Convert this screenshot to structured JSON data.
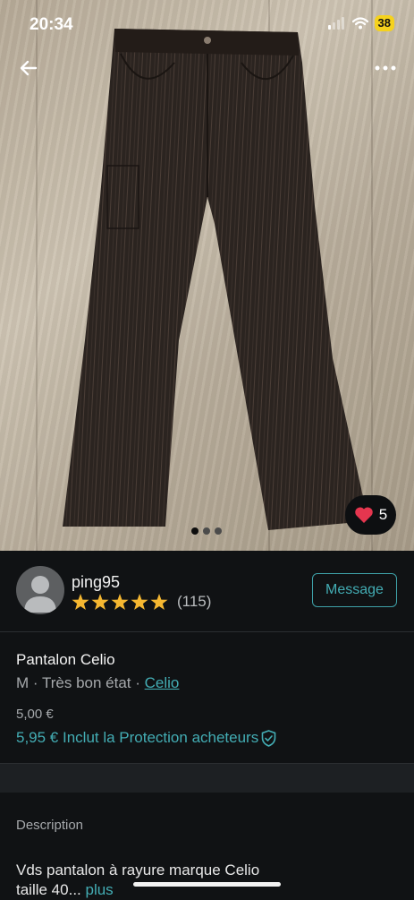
{
  "status_bar": {
    "time": "20:34",
    "battery": "38"
  },
  "photo": {
    "page_count": 3,
    "active_page": 1
  },
  "favorites": {
    "count": "5"
  },
  "seller": {
    "username": "ping95",
    "rating_stars": 5,
    "rating_count": "(115)",
    "message_label": "Message"
  },
  "item": {
    "title": "Pantalon Celio",
    "size": "M",
    "condition": "Très bon état",
    "brand": "Celio",
    "separator": " · ",
    "price": "5,00 €",
    "price_with_protection": "5,95 € Inclut la Protection acheteurs"
  },
  "description": {
    "heading": "Description",
    "line1": "Vds pantalon à rayure marque Celio",
    "line2": "taille 40...",
    "more_label": "plus"
  },
  "colors": {
    "accent": "#43adb4",
    "background": "#101214",
    "star": "#f5b731",
    "heart": "#e5364f"
  },
  "icons": [
    "back-arrow-icon",
    "more-icon",
    "heart-icon",
    "star-icon",
    "shield-check-icon",
    "signal-icon",
    "wifi-icon"
  ]
}
